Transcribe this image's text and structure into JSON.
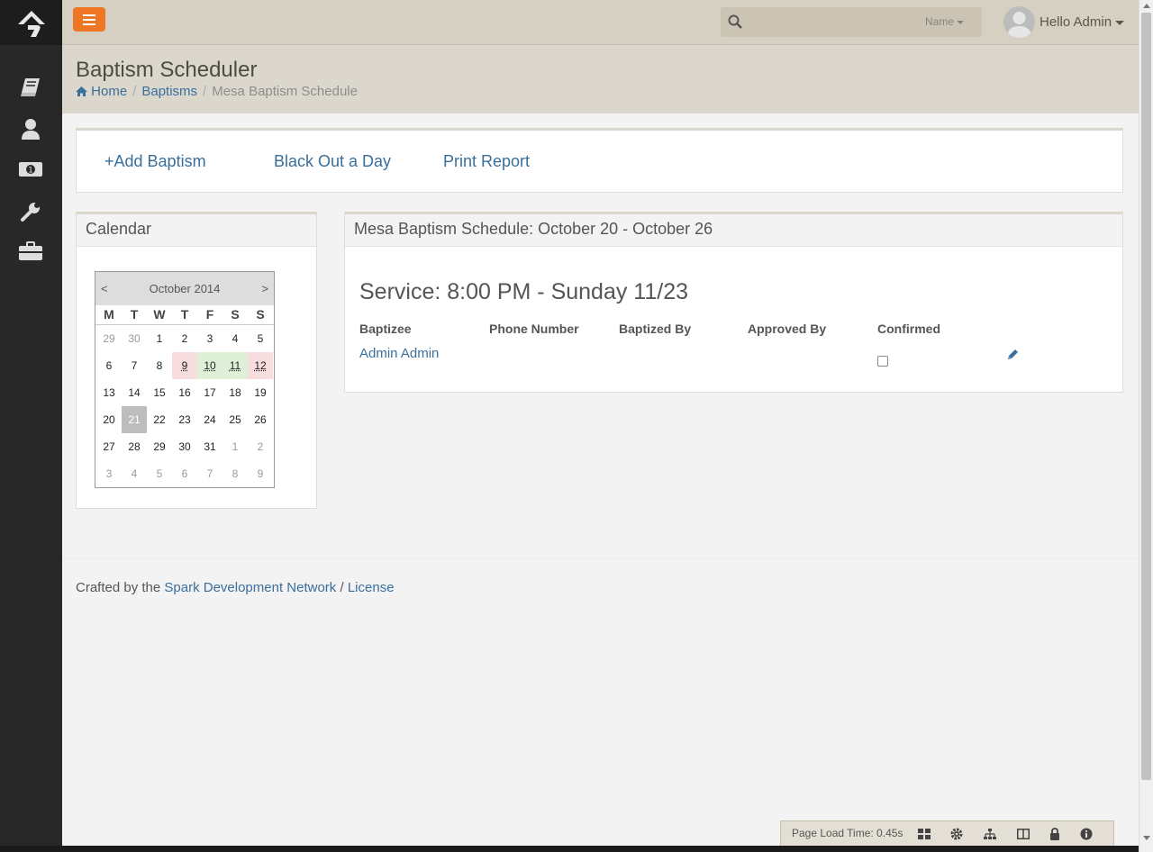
{
  "header": {
    "search_filter_label": "Name",
    "user_greeting": "Hello Admin"
  },
  "page": {
    "title": "Baptism Scheduler",
    "breadcrumb": [
      {
        "label": "Home"
      },
      {
        "label": "Baptisms"
      },
      {
        "label": "Mesa Baptism Schedule"
      }
    ]
  },
  "actions": {
    "add": "+Add Baptism",
    "blackout": "Black Out a Day",
    "print": "Print Report"
  },
  "calendar": {
    "heading": "Calendar",
    "prev": "<",
    "next": ">",
    "month": "October 2014",
    "weekdays": [
      "M",
      "T",
      "W",
      "T",
      "F",
      "S",
      "S"
    ],
    "days": [
      {
        "d": "29",
        "s": "other"
      },
      {
        "d": "30",
        "s": "other"
      },
      {
        "d": "1"
      },
      {
        "d": "2"
      },
      {
        "d": "3"
      },
      {
        "d": "4"
      },
      {
        "d": "5"
      },
      {
        "d": "6"
      },
      {
        "d": "7"
      },
      {
        "d": "8"
      },
      {
        "d": "9",
        "s": "red"
      },
      {
        "d": "10",
        "s": "green"
      },
      {
        "d": "11",
        "s": "green"
      },
      {
        "d": "12",
        "s": "red"
      },
      {
        "d": "13"
      },
      {
        "d": "14"
      },
      {
        "d": "15"
      },
      {
        "d": "16"
      },
      {
        "d": "17"
      },
      {
        "d": "18"
      },
      {
        "d": "19"
      },
      {
        "d": "20"
      },
      {
        "d": "21",
        "s": "selected"
      },
      {
        "d": "22"
      },
      {
        "d": "23"
      },
      {
        "d": "24"
      },
      {
        "d": "25"
      },
      {
        "d": "26"
      },
      {
        "d": "27"
      },
      {
        "d": "28"
      },
      {
        "d": "29"
      },
      {
        "d": "30"
      },
      {
        "d": "31"
      },
      {
        "d": "1",
        "s": "other"
      },
      {
        "d": "2",
        "s": "other"
      },
      {
        "d": "3",
        "s": "other"
      },
      {
        "d": "4",
        "s": "other"
      },
      {
        "d": "5",
        "s": "other"
      },
      {
        "d": "6",
        "s": "other"
      },
      {
        "d": "7",
        "s": "other"
      },
      {
        "d": "8",
        "s": "other"
      },
      {
        "d": "9",
        "s": "other"
      }
    ]
  },
  "schedule": {
    "heading": "Mesa Baptism Schedule: October 20 - October 26",
    "service": "Service: 8:00 PM - Sunday 11/23",
    "columns": [
      "Baptizee",
      "Phone Number",
      "Baptized By",
      "Approved By",
      "Confirmed"
    ],
    "rows": [
      {
        "baptizee": "Admin Admin",
        "phone": "",
        "baptized_by": "",
        "approved_by": "",
        "confirmed": false
      }
    ]
  },
  "footer": {
    "prefix": "Crafted by the",
    "link": "Spark Development Network",
    "separator": "/",
    "license": "License"
  },
  "admin_bar": {
    "load_time": "Page Load Time: 0.45s"
  },
  "colors": {
    "accent": "#ee7624",
    "link": "#3a6f9c",
    "sidebar": "#282828",
    "header": "#d6d0c3"
  }
}
